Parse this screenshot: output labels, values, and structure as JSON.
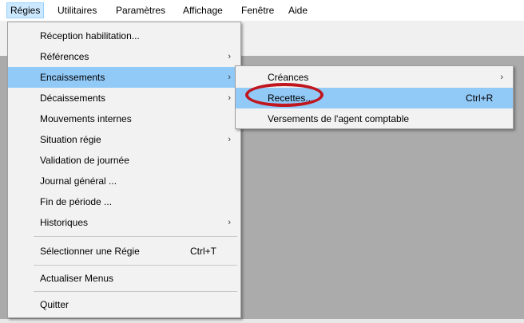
{
  "menubar": {
    "items": [
      "Régies",
      "Utilitaires",
      "Paramètres",
      "Affichage",
      "Fenêtre",
      "Aide"
    ]
  },
  "menu": {
    "items": [
      {
        "label": "Réception habilitation...",
        "submenu": false
      },
      {
        "label": "Références",
        "submenu": true
      },
      {
        "label": "Encaissements",
        "submenu": true,
        "highlighted": true
      },
      {
        "label": "Décaissements",
        "submenu": true
      },
      {
        "label": "Mouvements internes",
        "submenu": false
      },
      {
        "label": "Situation régie",
        "submenu": true
      },
      {
        "label": "Validation de journée",
        "submenu": false
      },
      {
        "label": "Journal général ...",
        "submenu": false
      },
      {
        "label": "Fin de période ...",
        "submenu": false
      },
      {
        "label": "Historiques",
        "submenu": true
      },
      {
        "label": "Sélectionner une Régie",
        "shortcut": "Ctrl+T"
      },
      {
        "label": "Actualiser Menus"
      },
      {
        "label": "Quitter"
      }
    ]
  },
  "submenu": {
    "items": [
      {
        "label": "Créances",
        "submenu": true
      },
      {
        "label": "Recettes...",
        "shortcut": "Ctrl+R",
        "highlighted": true
      },
      {
        "label": "Versements de l'agent comptable"
      }
    ]
  },
  "arrow_glyph": "›",
  "colors": {
    "highlight": "#91c9f7",
    "menu_background": "#f2f2f2",
    "workspace": "#ababab",
    "annotation_circle": "#c0161e"
  },
  "icons": [
    "chevron-right-icon"
  ]
}
